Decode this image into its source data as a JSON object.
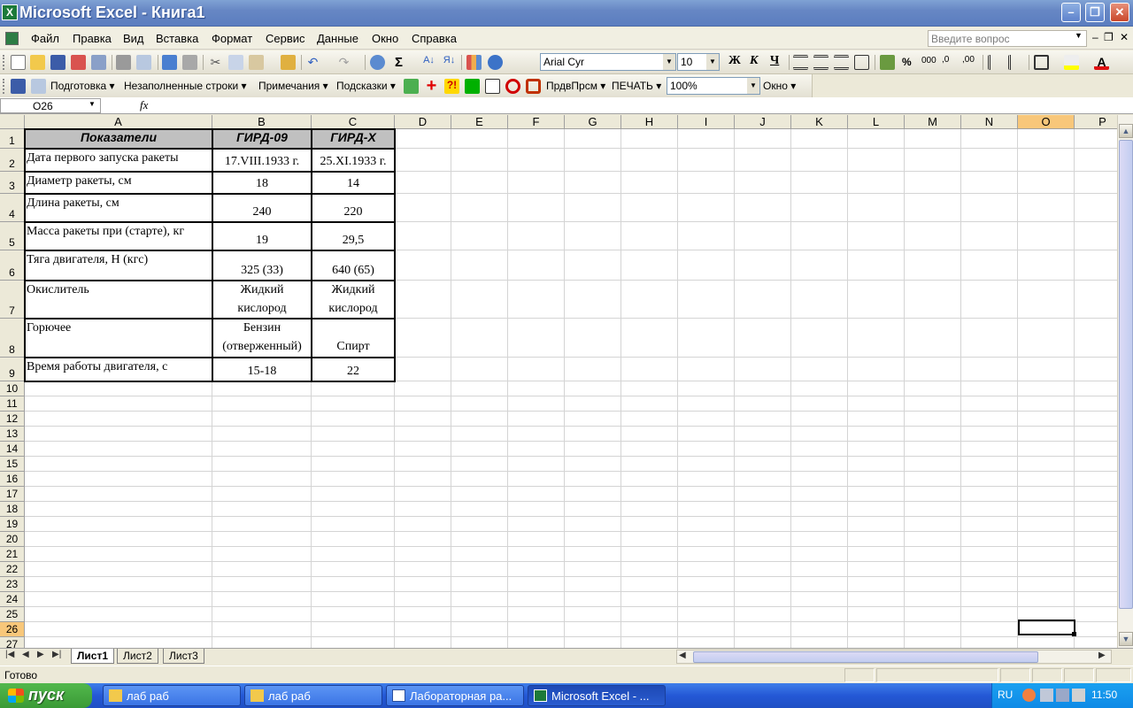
{
  "window": {
    "title": "Microsoft Excel - Книга1",
    "app_icon": "X"
  },
  "menu": {
    "items": [
      "Файл",
      "Правка",
      "Вид",
      "Вставка",
      "Формат",
      "Сервис",
      "Данные",
      "Окно",
      "Справка"
    ],
    "ask_placeholder": "Введите вопрос"
  },
  "formatting": {
    "font": "Arial Cyr",
    "size": "10",
    "bold": "Ж",
    "italic": "К",
    "underline": "Ч",
    "percent": "%",
    "thousands": "000"
  },
  "toolbar3": {
    "podgotovka": "Подготовка",
    "empty_rows": "Незаполненные строки",
    "notes": "Примечания",
    "hints": "Подсказки",
    "prdv": "ПрдвПрсм",
    "print": "ПЕЧАТЬ",
    "zoom": "100%",
    "window": "Окно",
    "sigma": "Σ"
  },
  "formula_bar": {
    "name_box": "O26",
    "fx": "fx",
    "content": ""
  },
  "columns": [
    "A",
    "B",
    "C",
    "D",
    "E",
    "F",
    "G",
    "H",
    "I",
    "J",
    "K",
    "L",
    "M",
    "N",
    "O",
    "P"
  ],
  "active_column": "O",
  "active_row": "26",
  "rows": [
    "1",
    "2",
    "3",
    "4",
    "5",
    "6",
    "7",
    "8",
    "9",
    "10",
    "11",
    "12",
    "13",
    "14",
    "15",
    "16",
    "17",
    "18",
    "19",
    "20",
    "21",
    "22",
    "23",
    "24",
    "25",
    "26",
    "27"
  ],
  "table": {
    "headers": [
      "Показатели",
      "ГИРД-09",
      "ГИРД-X"
    ],
    "rows": [
      {
        "label": "Дата первого запуска ракеты",
        "b1": "17.VIII.1933 г.",
        "b2": "",
        "c1": "25.XI.1933 г.",
        "c2": ""
      },
      {
        "label": "Диаметр ракеты, см",
        "b1": "18",
        "b2": "",
        "c1": "14",
        "c2": ""
      },
      {
        "label": "Длина ракеты, см",
        "b1": "240",
        "b2": "",
        "c1": "220",
        "c2": ""
      },
      {
        "label": "Масса ракеты при (старте), кг",
        "b1": "19",
        "b2": "",
        "c1": "29,5",
        "c2": ""
      },
      {
        "label": "Тяга двигателя, Н (кгс)",
        "b1": "325 (33)",
        "b2": "",
        "c1": "640 (65)",
        "c2": ""
      },
      {
        "label": "Окислитель",
        "b1": "Жидкий",
        "b2": "кислород",
        "c1": "Жидкий",
        "c2": "кислород"
      },
      {
        "label": "Горючее",
        "b1": "Бензин",
        "b2": "(отверженный)",
        "c1": "",
        "c2": "Спирт"
      },
      {
        "label": "Время работы двигателя, с",
        "b1": "15-18",
        "b2": "",
        "c1": "22",
        "c2": ""
      }
    ]
  },
  "sheets": [
    "Лист1",
    "Лист2",
    "Лист3"
  ],
  "active_sheet": "Лист1",
  "status": "Готово",
  "taskbar": {
    "start": "пуск",
    "tasks": [
      "лаб раб",
      "лаб раб",
      "Лабораторная ра...",
      "Microsoft Excel - ..."
    ],
    "lang": "RU",
    "clock": "11:50"
  }
}
